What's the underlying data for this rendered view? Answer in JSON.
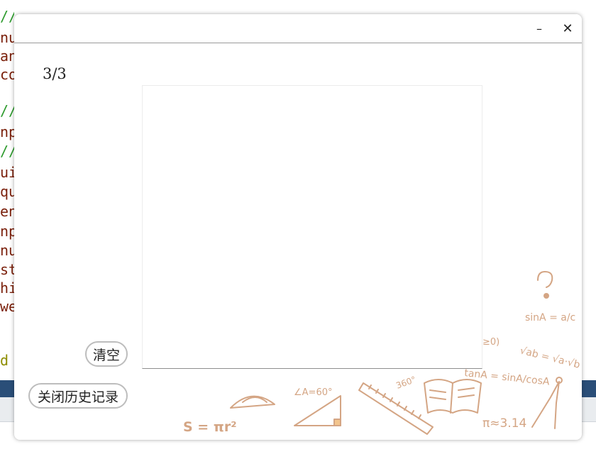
{
  "background_code": {
    "lines": [
      {
        "text": "//初始化",
        "kind": "c"
      },
      {
        "text": "nu",
        "kind": "k"
      },
      {
        "text": "an",
        "kind": "k"
      },
      {
        "text": "co",
        "kind": "k"
      },
      {
        "text": "//显",
        "kind": "c"
      },
      {
        "text": "np",
        "kind": "k"
      },
      {
        "text": "//技",
        "kind": "c"
      },
      {
        "text": "ui-",
        "kind": "k"
      },
      {
        "text": "qu",
        "kind": "k"
      },
      {
        "text": "en",
        "kind": "k"
      },
      {
        "text": "np",
        "kind": "k"
      },
      {
        "text": "nu",
        "kind": "k"
      },
      {
        "text": "sta",
        "kind": "k"
      },
      {
        "text": "his",
        "kind": "k"
      },
      {
        "text": "we",
        "kind": "k"
      },
      {
        "text": "d",
        "kind": "y"
      }
    ]
  },
  "dialog": {
    "minimize_glyph": "–",
    "close_glyph": "✕",
    "counter": "3/3",
    "clear_button": "清空",
    "close_history_button": "关闭历史记录"
  },
  "decoration": {
    "formulas": [
      "sinA = a/c",
      "√ab = √a·√b",
      "tanA = sinA/cosA",
      "π≈3.14",
      "S = πr²",
      "∠A=60°",
      "360°",
      "≥0)"
    ],
    "color": "#d4a584"
  }
}
